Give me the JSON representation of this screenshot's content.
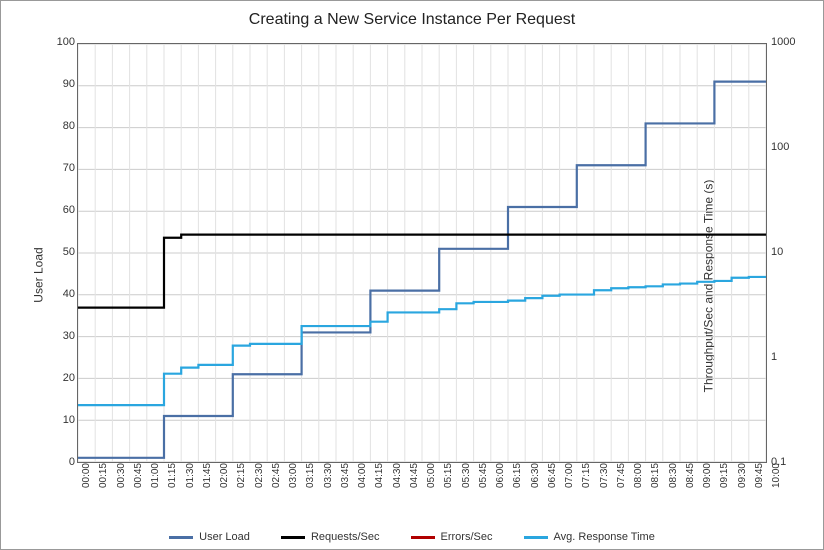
{
  "chart_data": {
    "type": "line",
    "title": "Creating a New Service Instance Per Request",
    "xlabel": "",
    "ylabel_left": "User Load",
    "ylabel_right": "Throughput/Sec and Response Time (s)",
    "left_axis": {
      "min": 0,
      "max": 100,
      "ticks": [
        0,
        10,
        20,
        30,
        40,
        50,
        60,
        70,
        80,
        90,
        100
      ]
    },
    "right_axis": {
      "min": 0.1,
      "max": 1000,
      "scale": "log",
      "ticks": [
        0.1,
        1,
        10,
        100,
        1000
      ]
    },
    "categories": [
      "00:00",
      "00:15",
      "00:30",
      "00:45",
      "01:00",
      "01:15",
      "01:30",
      "01:45",
      "02:00",
      "02:15",
      "02:30",
      "02:45",
      "03:00",
      "03:15",
      "03:30",
      "03:45",
      "04:00",
      "04:15",
      "04:30",
      "04:45",
      "05:00",
      "05:15",
      "05:30",
      "05:45",
      "06:00",
      "06:15",
      "06:30",
      "06:45",
      "07:00",
      "07:15",
      "07:30",
      "07:45",
      "08:00",
      "08:15",
      "08:30",
      "08:45",
      "09:00",
      "09:15",
      "09:30",
      "09:45",
      "10:00"
    ],
    "series": [
      {
        "name": "User Load",
        "axis": "left",
        "color": "#4a6fa5",
        "values": [
          1,
          1,
          1,
          1,
          1,
          11,
          11,
          11,
          11,
          21,
          21,
          21,
          21,
          31,
          31,
          31,
          31,
          41,
          41,
          41,
          41,
          51,
          51,
          51,
          51,
          61,
          61,
          61,
          61,
          71,
          71,
          71,
          71,
          81,
          81,
          81,
          81,
          91,
          91,
          91,
          91
        ]
      },
      {
        "name": "Requests/Sec",
        "axis": "right",
        "color": "#000000",
        "values": [
          3,
          3,
          3,
          3,
          3,
          14,
          15,
          15,
          15,
          15,
          15,
          15,
          15,
          15,
          15,
          15,
          15,
          15,
          15,
          15,
          15,
          15,
          15,
          15,
          15,
          15,
          15,
          15,
          15,
          15,
          15,
          15,
          15,
          15,
          15,
          15,
          15,
          15,
          15,
          15,
          15
        ]
      },
      {
        "name": "Errors/Sec",
        "axis": "right",
        "color": "#b00000",
        "values": [
          null,
          null,
          null,
          null,
          null,
          null,
          null,
          null,
          null,
          null,
          null,
          null,
          null,
          null,
          null,
          null,
          null,
          null,
          null,
          null,
          null,
          null,
          null,
          null,
          null,
          null,
          null,
          null,
          null,
          null,
          null,
          null,
          null,
          null,
          null,
          null,
          null,
          null,
          null,
          null,
          null
        ]
      },
      {
        "name": "Avg. Response Time",
        "axis": "right",
        "color": "#2aa6df",
        "values": [
          0.35,
          0.35,
          0.35,
          0.35,
          0.35,
          0.7,
          0.8,
          0.85,
          0.85,
          1.3,
          1.35,
          1.35,
          1.35,
          2.0,
          2.0,
          2.0,
          2.0,
          2.2,
          2.7,
          2.7,
          2.7,
          2.9,
          3.3,
          3.4,
          3.4,
          3.5,
          3.7,
          3.9,
          4.0,
          4.0,
          4.4,
          4.6,
          4.7,
          4.8,
          5.0,
          5.1,
          5.3,
          5.4,
          5.8,
          5.9,
          6.0
        ]
      }
    ],
    "legend": {
      "items": [
        "User Load",
        "Requests/Sec",
        "Errors/Sec",
        "Avg. Response Time"
      ]
    }
  }
}
